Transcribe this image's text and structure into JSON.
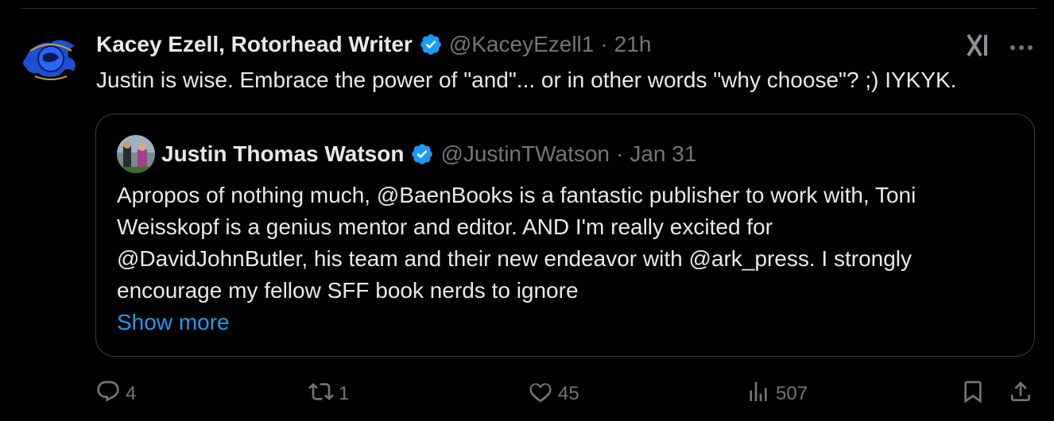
{
  "author": {
    "name": "Kacey Ezell, Rotorhead Writer",
    "handle": "@KaceyEzell1",
    "separator": "·",
    "time": "21h",
    "text": "Justin is wise. Embrace the power of \"and\"... or in other words \"why choose\"?  ;)  IYKYK."
  },
  "quoted": {
    "name": "Justin Thomas Watson",
    "handle": "@JustinTWatson",
    "separator": "·",
    "date": "Jan 31",
    "lines": [
      "Apropos of nothing much, @BaenBooks is a fantastic publisher to work with, Toni",
      "Weisskopf is a genius mentor and editor.  AND I'm really excited for",
      "@DavidJohnButler, his team and their new endeavor with @ark_press.    I strongly",
      "encourage my fellow SFF book nerds to ignore"
    ],
    "show_more": "Show more"
  },
  "actions": {
    "replies": "4",
    "reposts": "1",
    "likes": "45",
    "views": "507"
  },
  "colors": {
    "background": "#000000",
    "text": "#e7e9ea",
    "muted": "#71767b",
    "accent": "#1d9bf0",
    "border": "#3a3e42"
  },
  "icons": [
    "verified-badge-icon",
    "grok-icon",
    "more-icon",
    "reply-icon",
    "repost-icon",
    "like-icon",
    "views-icon",
    "bookmark-icon",
    "share-icon"
  ]
}
